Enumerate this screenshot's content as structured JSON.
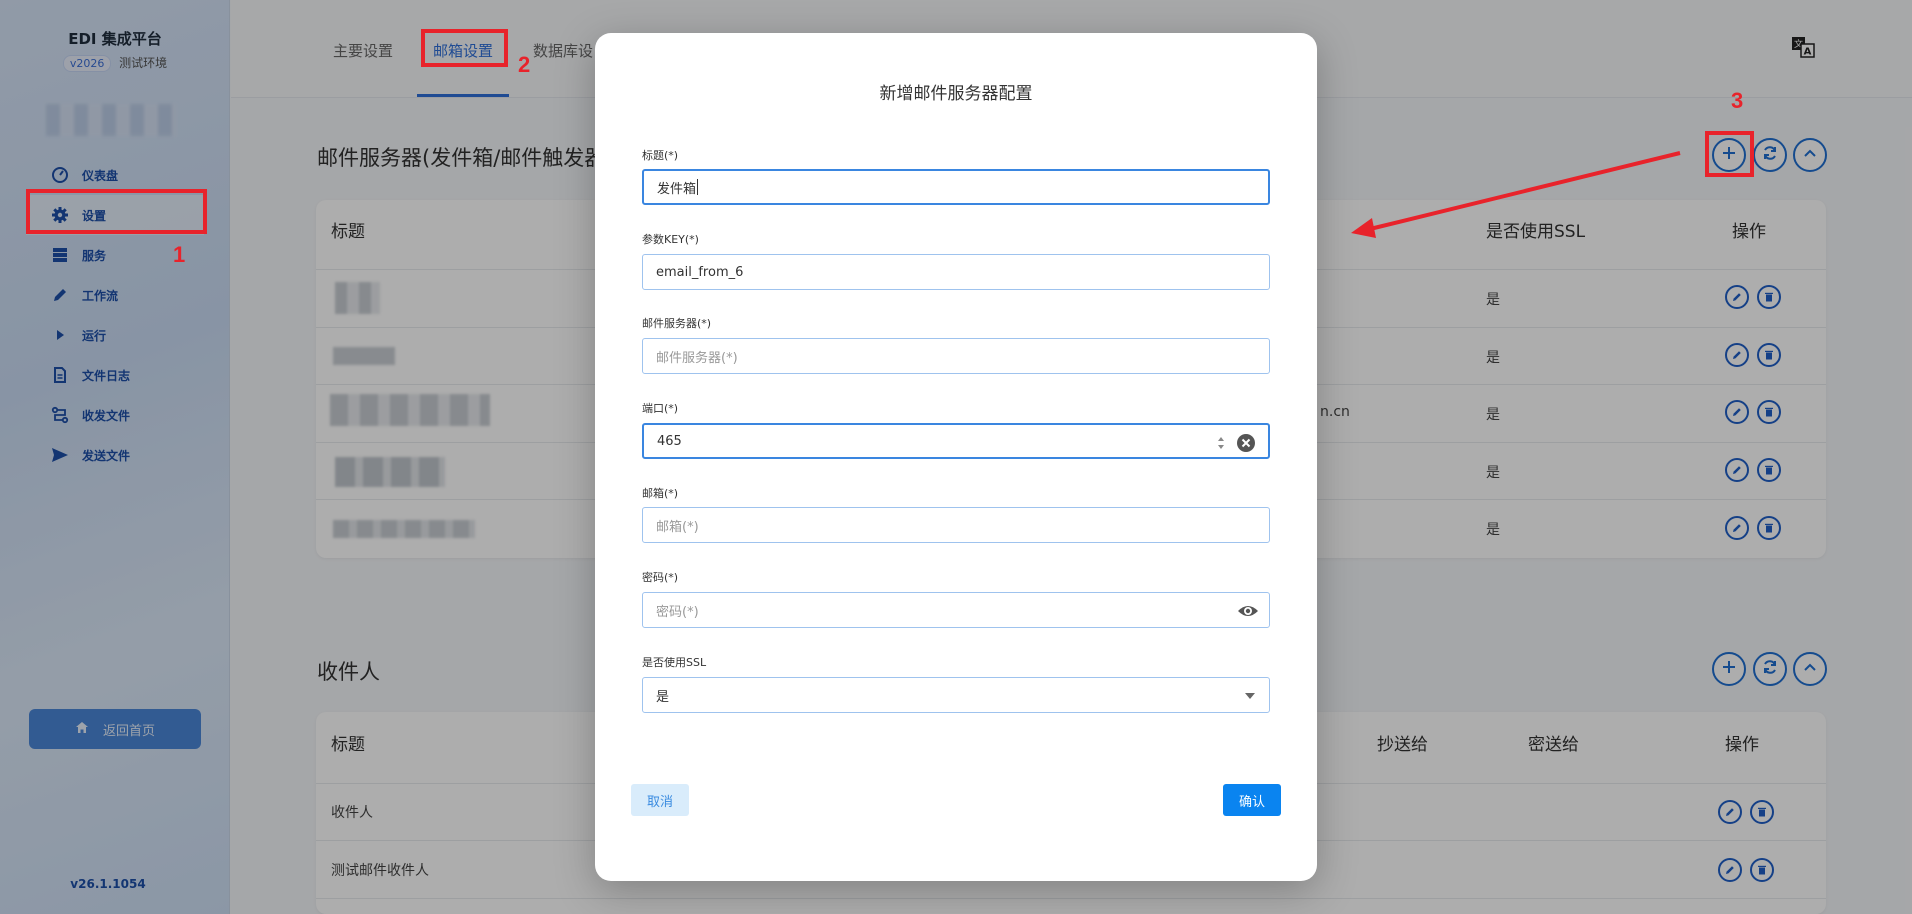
{
  "app": {
    "title": "EDI 集成平台",
    "env_badge": "v2026",
    "env_label": "测试环境",
    "version": "v26.1.1054"
  },
  "sidebar": {
    "items": [
      {
        "label": "仪表盘",
        "icon": "dashboard-icon"
      },
      {
        "label": "设置",
        "icon": "gear-icon"
      },
      {
        "label": "服务",
        "icon": "server-icon"
      },
      {
        "label": "工作流",
        "icon": "pencil-icon"
      },
      {
        "label": "运行",
        "icon": "play-icon"
      },
      {
        "label": "文件日志",
        "icon": "file-icon"
      },
      {
        "label": "收发文件",
        "icon": "transfer-icon"
      },
      {
        "label": "发送文件",
        "icon": "send-icon"
      }
    ],
    "home_button": "返回首页"
  },
  "tabs": [
    "主要设置",
    "邮箱设置",
    "数据库设"
  ],
  "mail_servers": {
    "title": "邮件服务器(发件箱/邮件触发器",
    "headers": {
      "title": "标题",
      "ssl": "是否使用SSL",
      "actions": "操作"
    },
    "rows": [
      {
        "ssl": "是",
        "host_tail": ""
      },
      {
        "ssl": "是",
        "host_tail": ""
      },
      {
        "ssl": "是",
        "host_tail": "n.cn"
      },
      {
        "ssl": "是",
        "host_tail": ""
      },
      {
        "ssl": "是",
        "host_tail": ""
      }
    ]
  },
  "recipients": {
    "title": "收件人",
    "headers": {
      "title": "标题",
      "cc": "抄送给",
      "bcc": "密送给",
      "actions": "操作"
    },
    "rows": [
      {
        "title": "收件人"
      },
      {
        "title": "测试邮件收件人"
      }
    ]
  },
  "dialog": {
    "title": "新增邮件服务器配置",
    "fields": {
      "title": {
        "label": "标题(*)",
        "value": "发件箱"
      },
      "key": {
        "label": "参数KEY(*)",
        "value": "email_from_6"
      },
      "server": {
        "label": "邮件服务器(*)",
        "placeholder": "邮件服务器(*)"
      },
      "port": {
        "label": "端口(*)",
        "value": "465"
      },
      "email": {
        "label": "邮箱(*)",
        "placeholder": "邮箱(*)"
      },
      "password": {
        "label": "密码(*)",
        "placeholder": "密码(*)"
      },
      "ssl": {
        "label": "是否使用SSL",
        "value": "是"
      }
    },
    "cancel": "取消",
    "confirm": "确认"
  },
  "annotations": {
    "n1": "1",
    "n2": "2",
    "n3": "3"
  },
  "colors": {
    "accent": "#2f6fd9",
    "annotation": "#e8232b",
    "confirm": "#0a84f0"
  }
}
